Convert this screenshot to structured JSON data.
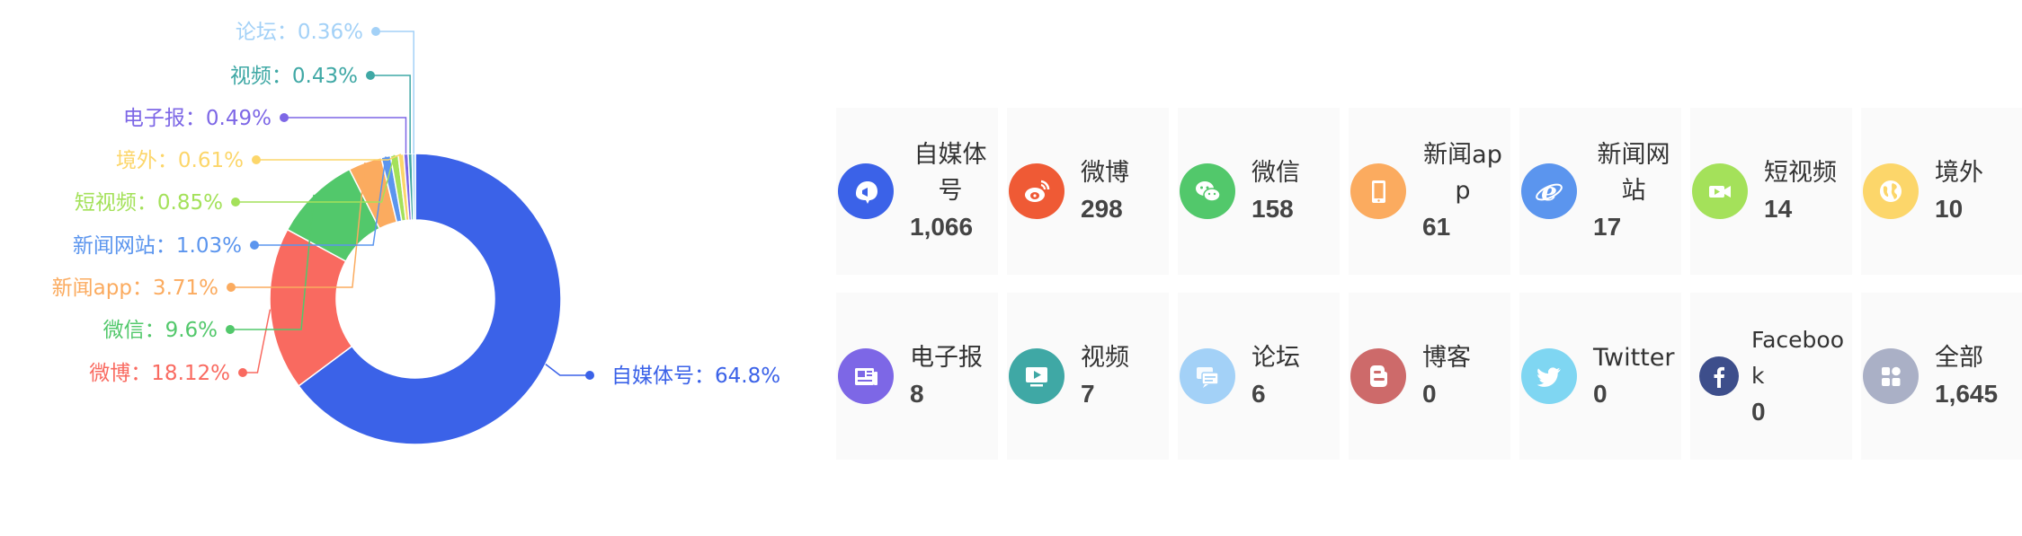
{
  "chart_data": {
    "type": "pie",
    "variant": "donut",
    "legend": "none",
    "slices": [
      {
        "name": "自媒体号",
        "value": 64.8,
        "label": "自媒体号：64.8%",
        "color": "#3b62e8"
      },
      {
        "name": "微博",
        "value": 18.12,
        "label": "微博：18.12%",
        "color": "#f96a60"
      },
      {
        "name": "微信",
        "value": 9.6,
        "label": "微信：9.6%",
        "color": "#52c86b"
      },
      {
        "name": "新闻app",
        "value": 3.71,
        "label": "新闻app：3.71%",
        "color": "#fbab5f"
      },
      {
        "name": "新闻网站",
        "value": 1.03,
        "label": "新闻网站：1.03%",
        "color": "#5b95ee"
      },
      {
        "name": "短视频",
        "value": 0.85,
        "label": "短视频：0.85%",
        "color": "#a4e15a"
      },
      {
        "name": "境外",
        "value": 0.61,
        "label": "境外：0.61%",
        "color": "#fcd66a"
      },
      {
        "name": "电子报",
        "value": 0.49,
        "label": "电子报：0.49%",
        "color": "#7d67e6"
      },
      {
        "name": "视频",
        "value": 0.43,
        "label": "视频：0.43%",
        "color": "#3fa8a5"
      },
      {
        "name": "论坛",
        "value": 0.36,
        "label": "论坛：0.36%",
        "color": "#a3d1f7"
      }
    ]
  },
  "stats": [
    {
      "label": "自媒体号",
      "count": "1,066",
      "icon": "megaphone-icon",
      "color": "#3b62e8"
    },
    {
      "label": "微博",
      "count": "298",
      "icon": "weibo-icon",
      "color": "#ef5a35"
    },
    {
      "label": "微信",
      "count": "158",
      "icon": "wechat-icon",
      "color": "#52c86b"
    },
    {
      "label": "新闻app",
      "count": "61",
      "icon": "phone-icon",
      "color": "#fbab5f"
    },
    {
      "label": "新闻网站",
      "count": "17",
      "icon": "ie-browser-icon",
      "color": "#5b95ee"
    },
    {
      "label": "短视频",
      "count": "14",
      "icon": "video-camera-icon",
      "color": "#a4e15a"
    },
    {
      "label": "境外",
      "count": "10",
      "icon": "globe-icon",
      "color": "#fcd66a"
    },
    {
      "label": "电子报",
      "count": "8",
      "icon": "newspaper-icon",
      "color": "#7d67e6"
    },
    {
      "label": "视频",
      "count": "7",
      "icon": "play-screen-icon",
      "color": "#3fa8a5"
    },
    {
      "label": "论坛",
      "count": "6",
      "icon": "chat-bubbles-icon",
      "color": "#a3d1f7"
    },
    {
      "label": "博客",
      "count": "0",
      "icon": "blogger-icon",
      "color": "#cd6a6a"
    },
    {
      "label": "Twitter",
      "count": "0",
      "icon": "twitter-icon",
      "color": "#7fd6f2"
    },
    {
      "label": "Facebook",
      "count": "0",
      "icon": "facebook-icon",
      "color": "#3d4e8b"
    },
    {
      "label": "全部",
      "count": "1,645",
      "icon": "grid-apps-icon",
      "color": "#aab0c6"
    }
  ]
}
